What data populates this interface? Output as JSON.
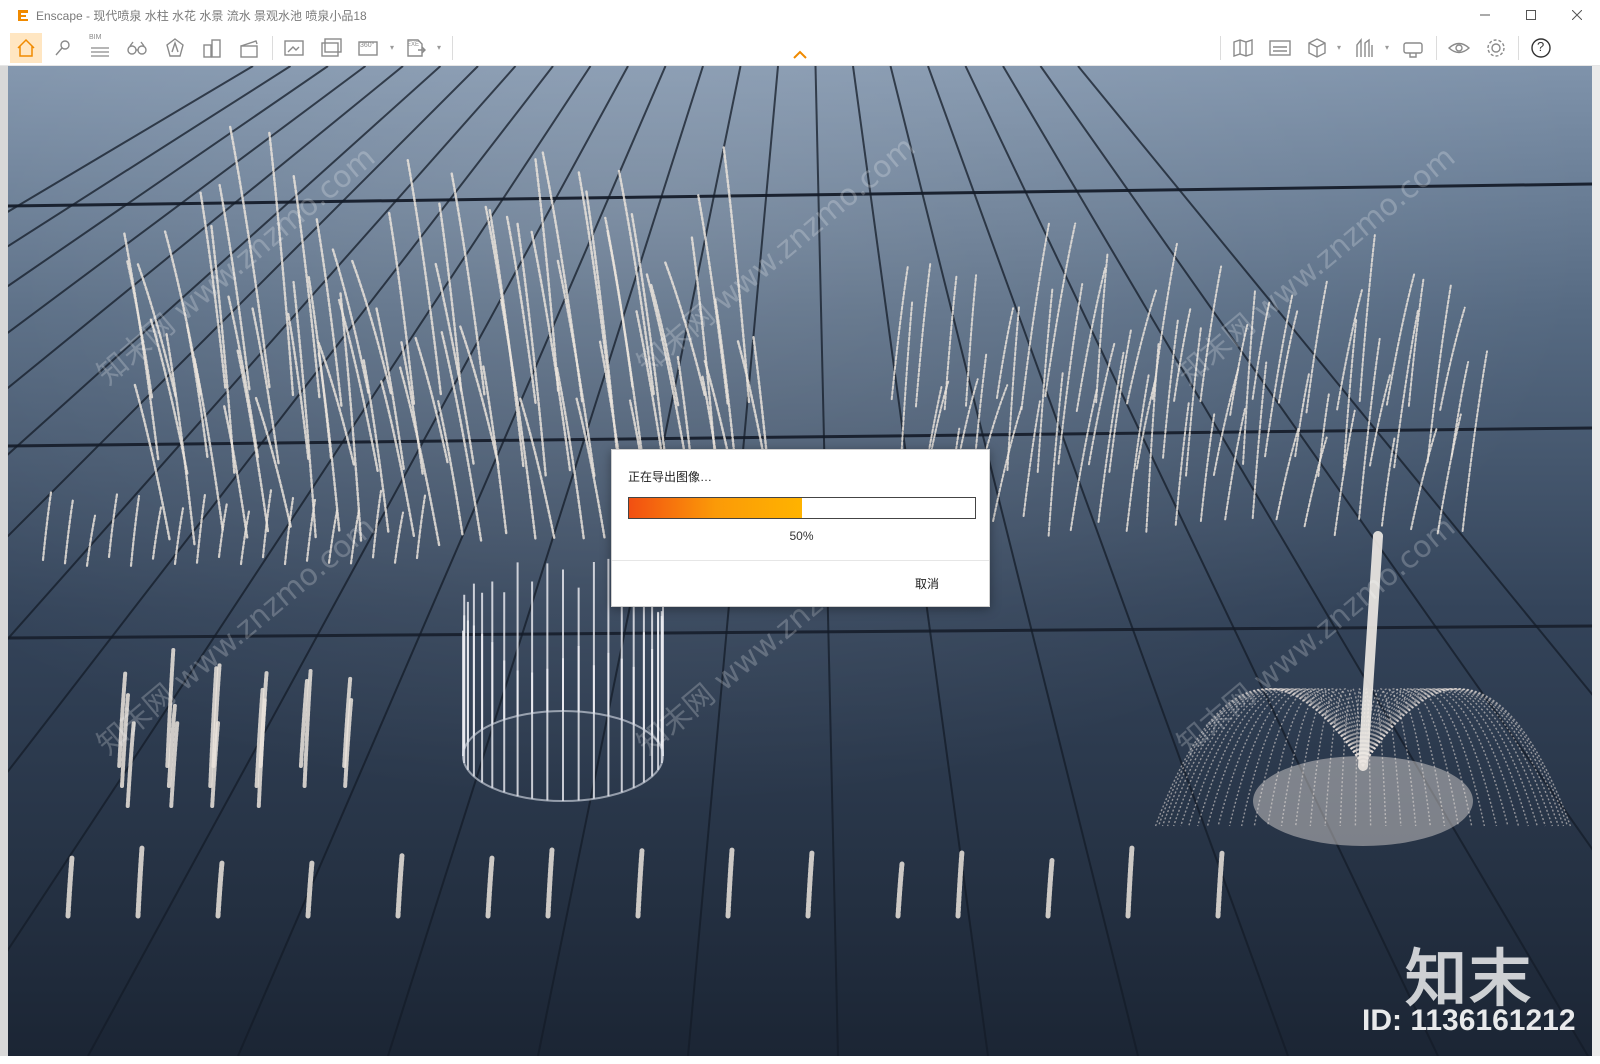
{
  "window": {
    "title": "Enscape - 现代喷泉 水柱 水花 水景 流水 景观水池 喷泉小品18",
    "controls": [
      "minimize-icon",
      "maximize-icon",
      "close-icon"
    ]
  },
  "toolbar": {
    "left_tools": [
      {
        "name": "home-icon",
        "active": true
      },
      {
        "name": "pin-icon"
      },
      {
        "name": "bim-icon",
        "label": "BIM"
      },
      {
        "name": "binoculars-icon"
      },
      {
        "name": "shape-icon"
      },
      {
        "name": "buildings-icon"
      },
      {
        "name": "clapperboard-icon"
      },
      {
        "name": "screenshot-icon"
      },
      {
        "name": "batch-render-icon"
      },
      {
        "name": "panorama-icon",
        "label": "360°"
      },
      {
        "name": "export-icon",
        "label": "EXE"
      }
    ],
    "right_tools": [
      {
        "name": "map-icon"
      },
      {
        "name": "objects-icon"
      },
      {
        "name": "cube-icon"
      },
      {
        "name": "materials-icon"
      },
      {
        "name": "vr-headset-icon"
      },
      {
        "name": "eye-icon"
      },
      {
        "name": "gear-icon"
      },
      {
        "name": "help-icon",
        "label": "?"
      }
    ]
  },
  "dialog": {
    "title": "正在导出图像…",
    "progress": 0.5,
    "progress_label": "50%",
    "cancel_label": "取消"
  },
  "watermark": {
    "brand": "知末",
    "id": "ID: 1136161212",
    "diagonal_text": "知末网 www.znzmo.com"
  },
  "colors": {
    "accent": "#f08a00",
    "progress_start": "#f24f12",
    "progress_end": "#ffb300",
    "water_dark": "#1e2a38",
    "sky": "#7f93ab"
  }
}
